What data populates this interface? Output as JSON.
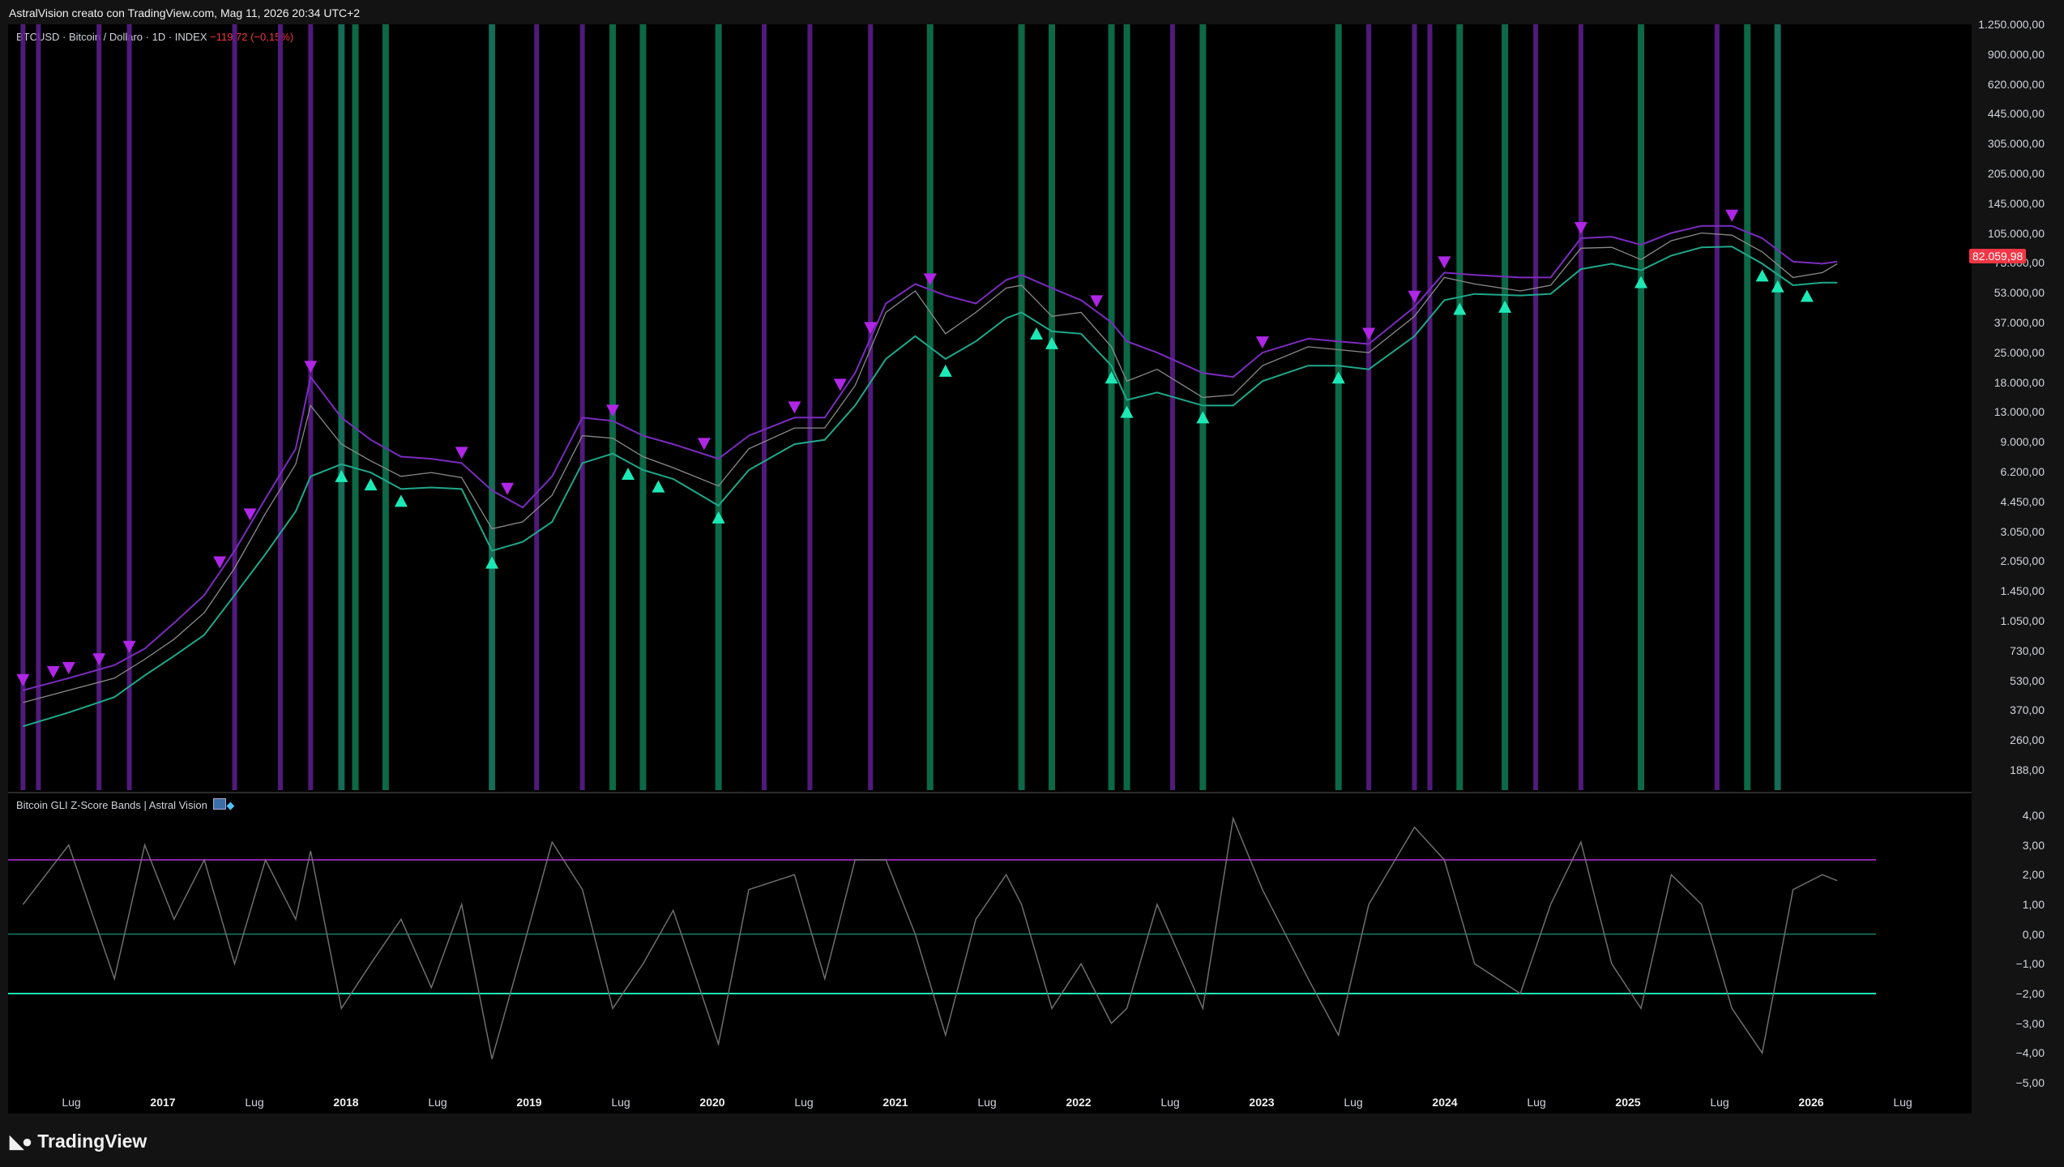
{
  "header": {
    "credit": "AstralVision creato con TradingView.com, Mag 11, 2026 20:34 UTC+2"
  },
  "main_pane": {
    "symbol_legend": "BTCUSD · Bitcoin / Dollaro · 1D · INDEX",
    "change": "−119,72 (−0,15%)",
    "last_price": "82.059,98",
    "colors": {
      "price": "#8a8a8a",
      "upper_band": "#7b2cbf",
      "lower_band": "#1fa88a",
      "bearish_marker": "#b026e6",
      "bullish_marker": "#1de9b6",
      "purple_zone": "#5e1f8f",
      "green_zone": "#0e7a52"
    }
  },
  "indicator_pane": {
    "title": "Bitcoin GLI Z-Score Bands | Astral Vision",
    "title_icons": [
      "chart-emoji-icon",
      "diamond-icon"
    ],
    "colors": {
      "line": "#6e6e6e",
      "upper": "#8e24aa",
      "lower": "#1de9b6",
      "zero": "#1b7d6a"
    }
  },
  "footer": {
    "brand": "TradingView"
  },
  "chart_data": [
    {
      "type": "line",
      "title": "BTCUSD · Bitcoin / Dollaro · 1D · INDEX",
      "y_scale": "log",
      "y_ticks": [
        "1.250.000,00",
        "900.000,00",
        "620.000,00",
        "445.000,00",
        "305.000,00",
        "205.000,00",
        "145.000,00",
        "105.000,00",
        "73.000,00",
        "53.000,00",
        "37.000,00",
        "25.000,00",
        "18.000,00",
        "13.000,00",
        "9.000,00",
        "6.200,00",
        "4.450,00",
        "3.050,00",
        "2.050,00",
        "1.450,00",
        "1.050,00",
        "730,00",
        "530,00",
        "370,00",
        "260,00",
        "188,00"
      ],
      "x_labels": [
        "Lug",
        "2017",
        "Lug",
        "2018",
        "Lug",
        "2019",
        "Lug",
        "2020",
        "Lug",
        "2021",
        "Lug",
        "2022",
        "Lug",
        "2023",
        "Lug",
        "2024",
        "Lug",
        "2025",
        "Lug",
        "2026",
        "Lug"
      ],
      "x": [
        "2016-05",
        "2016-08",
        "2016-11",
        "2017-01",
        "2017-03",
        "2017-05",
        "2017-07",
        "2017-09",
        "2017-11",
        "2017-12",
        "2018-02",
        "2018-04",
        "2018-06",
        "2018-08",
        "2018-10",
        "2018-12",
        "2019-02",
        "2019-04",
        "2019-06",
        "2019-08",
        "2019-10",
        "2019-12",
        "2020-03",
        "2020-05",
        "2020-08",
        "2020-10",
        "2020-12",
        "2021-02",
        "2021-04",
        "2021-06",
        "2021-08",
        "2021-10",
        "2021-11",
        "2022-01",
        "2022-03",
        "2022-05",
        "2022-06",
        "2022-08",
        "2022-11",
        "2023-01",
        "2023-03",
        "2023-06",
        "2023-08",
        "2023-10",
        "2024-01",
        "2024-03",
        "2024-05",
        "2024-08",
        "2024-10",
        "2024-12",
        "2025-02",
        "2025-04",
        "2025-06",
        "2025-08",
        "2025-10",
        "2025-12",
        "2026-02",
        "2026-04",
        "2026-05"
      ],
      "series": [
        {
          "values": [
            450,
            520,
            600,
            750,
            950,
            1300,
            2200,
            4200,
            7500,
            15000,
            9500,
            7800,
            6500,
            6800,
            6400,
            3500,
            3800,
            5200,
            10500,
            10200,
            8200,
            7200,
            5800,
            9000,
            11500,
            11500,
            19000,
            45000,
            58000,
            35000,
            45000,
            60000,
            62000,
            43000,
            45000,
            30000,
            20000,
            23000,
            16500,
            17000,
            24000,
            30000,
            29000,
            28000,
            43000,
            68000,
            63000,
            58000,
            62000,
            96000,
            97000,
            84000,
            105000,
            115000,
            112000,
            92000,
            68000,
            72000,
            80000
          ]
        },
        {
          "values": [
            520,
            600,
            700,
            850,
            1150,
            1600,
            2700,
            5000,
            9000,
            21000,
            13000,
            10000,
            8200,
            8000,
            7600,
            5500,
            4500,
            6500,
            13000,
            12500,
            10500,
            9500,
            8000,
            10500,
            13000,
            13000,
            22000,
            50000,
            63000,
            55000,
            50000,
            66000,
            70000,
            60000,
            52000,
            40000,
            32000,
            28000,
            22000,
            21000,
            28000,
            33000,
            32000,
            31000,
            48000,
            72000,
            70000,
            68000,
            68000,
            108000,
            110000,
            100000,
            115000,
            125000,
            125000,
            108000,
            82000,
            80000,
            82000
          ]
        },
        {
          "values": [
            340,
            400,
            480,
            620,
            780,
            1000,
            1600,
            2600,
            4300,
            6500,
            7500,
            6800,
            5600,
            5700,
            5600,
            2700,
            3000,
            3800,
            7600,
            8500,
            7000,
            6300,
            4600,
            7000,
            9500,
            10000,
            15000,
            26000,
            34000,
            26000,
            32000,
            42000,
            45000,
            36000,
            35000,
            24000,
            16000,
            17500,
            15000,
            15000,
            20000,
            24000,
            24000,
            23000,
            34000,
            52000,
            56000,
            55000,
            56000,
            75000,
            80000,
            74000,
            88000,
            97000,
            98000,
            80000,
            62000,
            64000,
            64000
          ]
        }
      ],
      "bearish_markers": [
        "2016-05",
        "2016-07",
        "2016-08",
        "2016-10",
        "2016-12",
        "2017-06",
        "2017-08",
        "2017-12",
        "2018-10",
        "2019-01",
        "2019-08",
        "2020-02",
        "2020-08",
        "2020-11",
        "2021-01",
        "2021-05",
        "2022-04",
        "2023-03",
        "2023-10",
        "2024-01",
        "2024-03",
        "2024-12",
        "2025-10"
      ],
      "bullish_markers": [
        "2018-02",
        "2018-04",
        "2018-06",
        "2018-12",
        "2019-09",
        "2019-11",
        "2020-03",
        "2021-06",
        "2021-12",
        "2022-01",
        "2022-05",
        "2022-06",
        "2022-11",
        "2023-08",
        "2024-04",
        "2024-07",
        "2025-04",
        "2025-12",
        "2026-01",
        "2026-03"
      ],
      "purple_zones": [
        "2016-05",
        "2016-06",
        "2016-10",
        "2016-12",
        "2017-07",
        "2017-10",
        "2017-12",
        "2018-02",
        "2018-12",
        "2019-03",
        "2019-06",
        "2020-06",
        "2020-09",
        "2021-01",
        "2022-09",
        "2023-10",
        "2024-01",
        "2024-02",
        "2024-09",
        "2024-12",
        "2025-09",
        "2026-01"
      ],
      "green_zones": [
        "2018-02",
        "2018-03",
        "2018-05",
        "2018-12",
        "2019-08",
        "2019-10",
        "2020-03",
        "2021-05",
        "2021-11",
        "2022-01",
        "2022-05",
        "2022-06",
        "2022-11",
        "2023-08",
        "2024-04",
        "2024-07",
        "2025-04",
        "2025-11",
        "2026-01"
      ]
    },
    {
      "type": "line",
      "title": "Bitcoin GLI Z-Score Bands | Astral Vision",
      "y_ticks": [
        "4,00",
        "3,00",
        "2,00",
        "1,00",
        "0,00",
        "−1,00",
        "−2,00",
        "−3,00",
        "−4,00",
        "−5,00"
      ],
      "ylim": [
        -5,
        4
      ],
      "bands": {
        "upper": 2.5,
        "zero": 0,
        "lower": -2
      },
      "x": [
        "2016-05",
        "2016-08",
        "2016-11",
        "2017-01",
        "2017-03",
        "2017-05",
        "2017-07",
        "2017-09",
        "2017-11",
        "2017-12",
        "2018-02",
        "2018-04",
        "2018-06",
        "2018-08",
        "2018-10",
        "2018-12",
        "2019-02",
        "2019-04",
        "2019-06",
        "2019-08",
        "2019-10",
        "2019-12",
        "2020-03",
        "2020-05",
        "2020-08",
        "2020-10",
        "2020-12",
        "2021-02",
        "2021-04",
        "2021-06",
        "2021-08",
        "2021-10",
        "2021-11",
        "2022-01",
        "2022-03",
        "2022-05",
        "2022-06",
        "2022-08",
        "2022-11",
        "2023-01",
        "2023-03",
        "2023-06",
        "2023-08",
        "2023-10",
        "2024-01",
        "2024-03",
        "2024-05",
        "2024-08",
        "2024-10",
        "2024-12",
        "2025-02",
        "2025-04",
        "2025-06",
        "2025-08",
        "2025-10",
        "2025-12",
        "2026-02",
        "2026-04",
        "2026-05"
      ],
      "series": [
        {
          "values": [
            1.0,
            3.0,
            -1.5,
            3.0,
            0.5,
            2.5,
            -1.0,
            2.5,
            0.5,
            2.8,
            -2.5,
            -1.0,
            0.5,
            -1.8,
            1.0,
            -4.2,
            -0.5,
            3.1,
            1.5,
            -2.5,
            -1.0,
            0.8,
            -3.7,
            1.5,
            2.0,
            -1.5,
            2.5,
            2.5,
            0.0,
            -3.4,
            0.5,
            2.0,
            1.0,
            -2.5,
            -1.0,
            -3.0,
            -2.5,
            1.0,
            -2.5,
            3.9,
            1.5,
            -1.5,
            -3.4,
            1.0,
            3.6,
            2.5,
            -1.0,
            -2.0,
            1.0,
            3.1,
            -1.0,
            -2.5,
            2.0,
            1.0,
            -2.5,
            -4.0,
            1.5,
            2.0,
            1.8
          ]
        }
      ]
    }
  ]
}
